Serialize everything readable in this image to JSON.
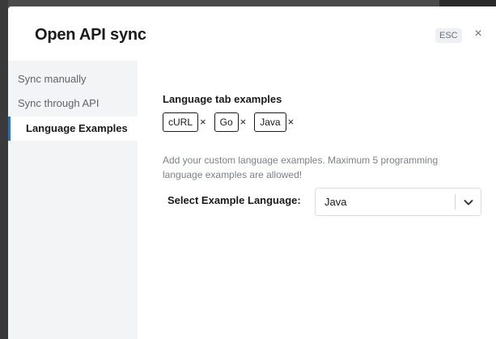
{
  "modal": {
    "title": "Open API sync",
    "esc_label": "ESC",
    "close_glyph": "×"
  },
  "sidebar": {
    "items": [
      {
        "label": "Sync manually",
        "active": false
      },
      {
        "label": "Sync through API",
        "active": false
      },
      {
        "label": "Language Examples",
        "active": true
      }
    ]
  },
  "language_tabs": {
    "heading": "Language tab examples",
    "chips": [
      {
        "label": "cURL",
        "remove_glyph": "×"
      },
      {
        "label": "Go",
        "remove_glyph": "×"
      },
      {
        "label": "Java",
        "remove_glyph": "×"
      }
    ]
  },
  "help_text": "Add your custom language examples. Maximum 5 programming language examples are allowed!",
  "select": {
    "label": "Select Example Language:",
    "value": "Java",
    "icon": "chevron-down-icon"
  },
  "colors": {
    "accent": "#2f6fb0",
    "sidebar_bg": "#f3f4f6",
    "text_primary": "#1a1a1a",
    "text_muted": "#7c8088"
  }
}
